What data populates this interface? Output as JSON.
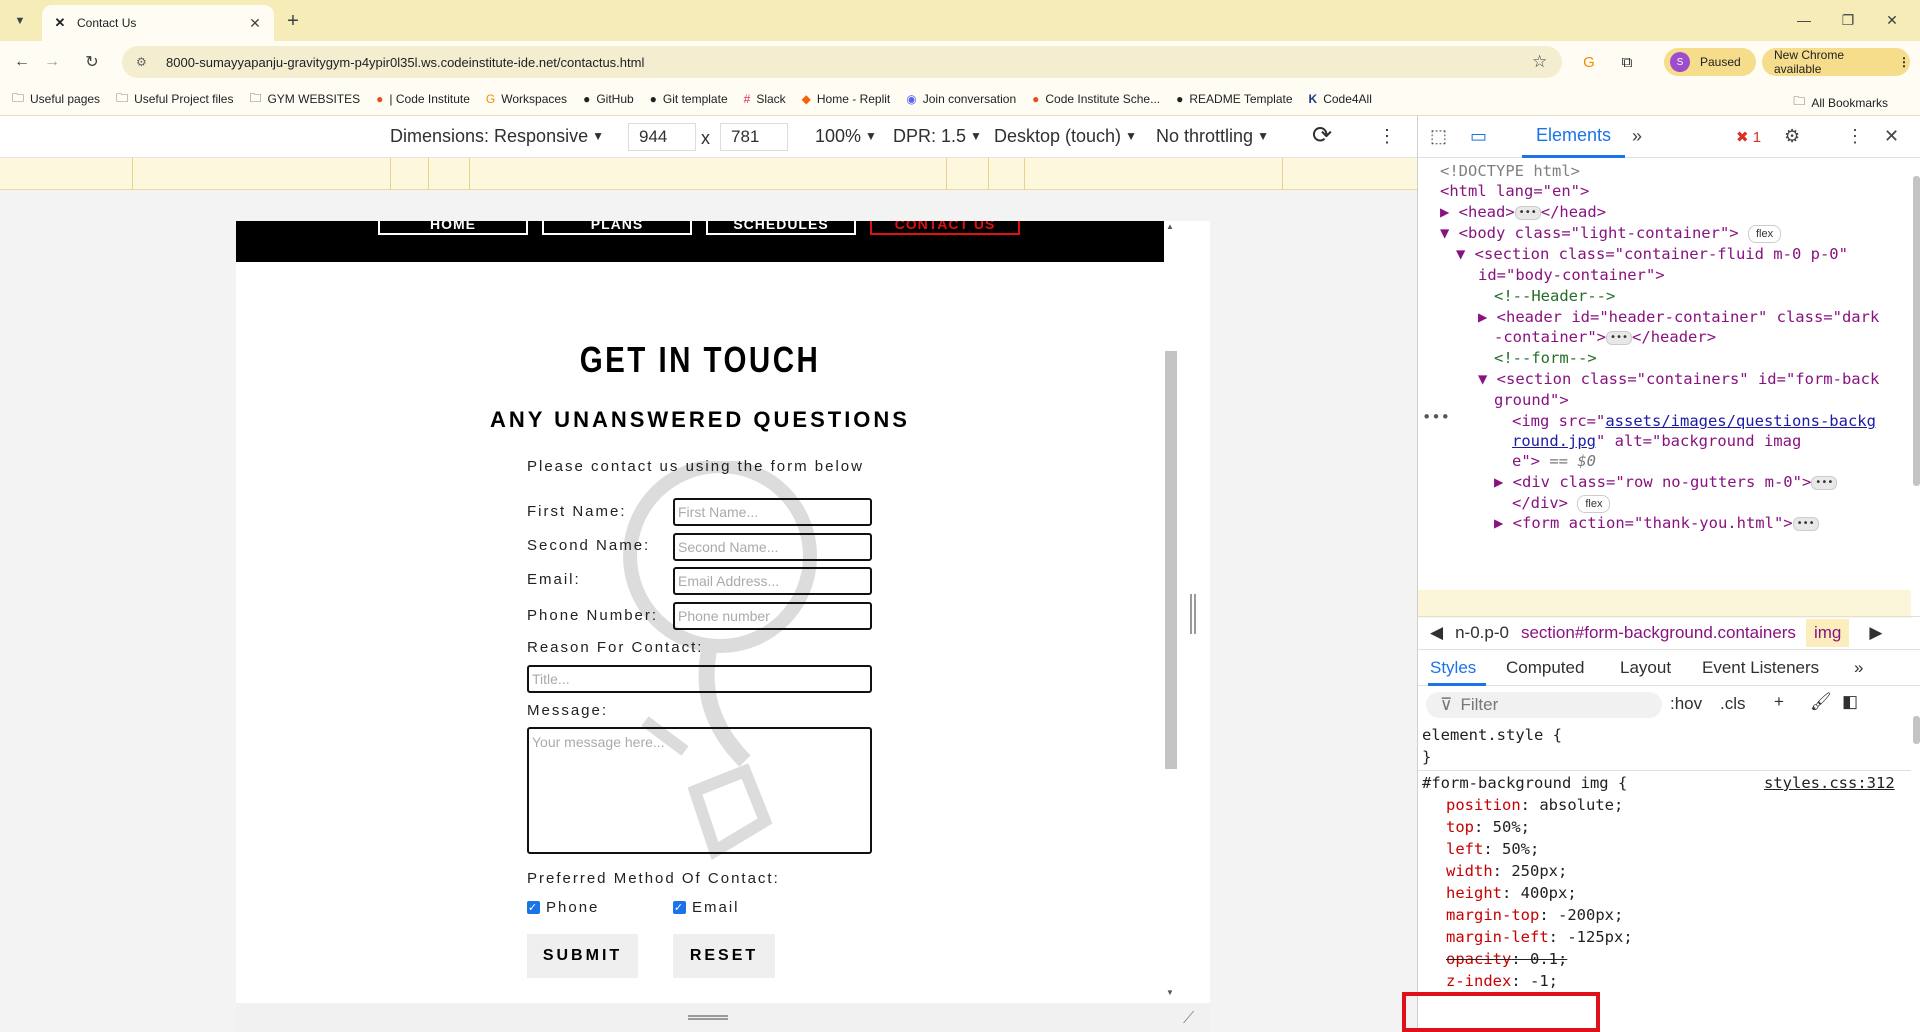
{
  "browser": {
    "tab_title": "Contact Us",
    "url": "8000-sumayyapanju-gravitygym-p4ypir0l35l.ws.codeinstitute-ide.net/contactus.html",
    "profile_initial": "S",
    "paused_label": "Paused",
    "new_chrome_label": "New Chrome available",
    "bookmarks": [
      {
        "label": "Useful pages",
        "icon": "folder-icon"
      },
      {
        "label": "Useful Project files",
        "icon": "folder-icon"
      },
      {
        "label": "GYM WEBSITES",
        "icon": "folder-icon"
      },
      {
        "label": "| Code Institute",
        "icon": "code-institute-icon"
      },
      {
        "label": "Workspaces",
        "icon": "gitpod-icon"
      },
      {
        "label": "GitHub",
        "icon": "github-icon"
      },
      {
        "label": "Git template",
        "icon": "github-icon"
      },
      {
        "label": "Slack",
        "icon": "slack-icon"
      },
      {
        "label": "Home - Replit",
        "icon": "replit-icon"
      },
      {
        "label": "Join conversation",
        "icon": "discord-icon"
      },
      {
        "label": "Code Institute Sche...",
        "icon": "code-institute-icon"
      },
      {
        "label": "README Template",
        "icon": "github-icon"
      },
      {
        "label": "Code4All",
        "icon": "code4all-icon"
      }
    ],
    "all_bookmarks_label": "All Bookmarks"
  },
  "device_toolbar": {
    "dimensions_label": "Dimensions: Responsive",
    "width": "944",
    "times": "x",
    "height": "781",
    "zoom": "100%",
    "dpr": "DPR: 1.5",
    "device_type": "Desktop (touch)",
    "throttling": "No throttling"
  },
  "site": {
    "nav": [
      "HOME",
      "PLANS",
      "SCHEDULES",
      "CONTACT US"
    ],
    "title": "GET IN TOUCH",
    "subtitle": "ANY UNANSWERED QUESTIONS",
    "description": "Please contact us using the form below",
    "labels": {
      "first_name": "First Name:",
      "second_name": "Second Name:",
      "email": "Email:",
      "phone": "Phone Number:",
      "reason": "Reason For Contact:",
      "message": "Message:",
      "preferred": "Preferred Method Of Contact:"
    },
    "placeholders": {
      "first_name": "First Name...",
      "second_name": "Second Name...",
      "email": "Email Address...",
      "phone": "Phone number",
      "reason": "Title...",
      "message": "Your message here..."
    },
    "checkboxes": {
      "phone": "Phone",
      "email": "Email"
    },
    "submit_label": "SUBMIT",
    "reset_label": "RESET"
  },
  "devtools": {
    "elements_tab": "Elements",
    "error_count": "1",
    "dom": {
      "doctype": "<!DOCTYPE html>",
      "html_open": "<html lang=\"en\">",
      "head": "<head>",
      "head_close": "</head>",
      "body_tag": "<body class=\"light-container\">",
      "flex_badge": "flex",
      "section_line1": "<section class=\"container-fluid m-0 p-0\"",
      "section_line2": "id=\"body-container\">",
      "comment_header": "<!--Header-->",
      "header_line1": "<header id=\"header-container\" class=\"dark",
      "header_line2": "-container\">",
      "header_close": "</header>",
      "comment_form": "<!--form-->",
      "section2_line1": "<section class=\"containers\" id=\"form-back",
      "section2_line2": "ground\">",
      "img_line1_pre": "<img src=\"",
      "img_link1": "assets/images/questions-backg",
      "img_link2": "round.jpg",
      "img_line2_post": "\" alt=\"background imag",
      "img_line3": "e\">",
      "img_line3_eq": "== $0",
      "div_line": "<div class=\"row no-gutters m-0\">",
      "div_close": "</div>",
      "form_line": "<form action=\"thank-you.html\">"
    },
    "breadcrumbs": [
      "n-0.p-0",
      "section#form-background.containers",
      "img"
    ],
    "styles_tabs": [
      "Styles",
      "Computed",
      "Layout",
      "Event Listeners"
    ],
    "filter_placeholder": "Filter",
    "filter_tools": [
      ":hov",
      ".cls"
    ],
    "element_style": "element.style {",
    "close_brace": "}",
    "rule_selector": "#form-background img {",
    "rule_source": "styles.css:312",
    "declarations": [
      {
        "prop": "position",
        "value": "absolute;"
      },
      {
        "prop": "top",
        "value": "50%;"
      },
      {
        "prop": "left",
        "value": "50%;"
      },
      {
        "prop": "width",
        "value": "250px;"
      },
      {
        "prop": "height",
        "value": "400px;"
      },
      {
        "prop": "margin-top",
        "value": "-200px;"
      },
      {
        "prop": "margin-left",
        "value": "-125px;"
      },
      {
        "prop": "opacity",
        "value": "0.1;"
      },
      {
        "prop": "z-index",
        "value": "-1;"
      }
    ]
  }
}
